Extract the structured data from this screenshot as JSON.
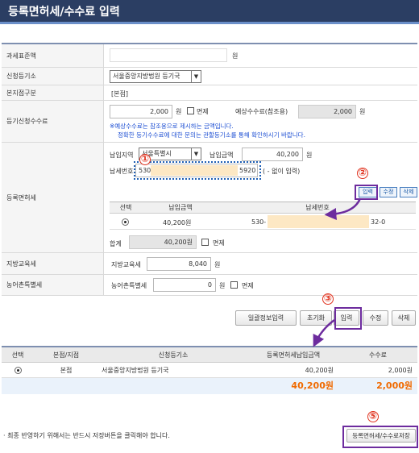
{
  "title": "등록면허세/수수료 입력",
  "fields": {
    "tax_base": {
      "label": "과세표준액",
      "value": "",
      "unit": "원"
    },
    "registry": {
      "label": "신청등기소",
      "selected": "서울중앙지방법원 등기국"
    },
    "branch": {
      "label": "본지점구분",
      "value": "[본점]"
    },
    "fee": {
      "label": "등기신청수수료",
      "value": "2,000",
      "unit": "원",
      "exempt_label": "면제",
      "expected_label": "예상수수료(참조용)",
      "expected_value": "2,000",
      "expected_unit": "원",
      "note1": "※예상수수료는 참조용으로 제시하는 금액입니다.",
      "note2": "정확한 등기수수료에 대한 문의는 관할등기소를 통해 확인하시기 바랍니다."
    },
    "license_tax": {
      "label": "등록면허세",
      "region_label": "납입지역",
      "region_value": "서울특별시",
      "amount_label": "납입금액",
      "amount_value": "40,200",
      "amount_unit": "원",
      "payno_label": "납세번호",
      "payno_prefix": "530",
      "payno_suffix": "5920",
      "payno_hint": "( - 없이 입력)",
      "btn_input": "입력",
      "btn_edit": "수정",
      "btn_delete": "삭제",
      "table_headers": [
        "선택",
        "납입금액",
        "납세번호"
      ],
      "table_row": {
        "amount": "40,200원",
        "payno_prefix": "530-",
        "payno_suffix": "32-0"
      },
      "total_label": "합계",
      "total_value": "40,200원",
      "total_exempt_label": "면제"
    },
    "local_edu_tax": {
      "label": "지방교육세",
      "inner_label": "지방교육세",
      "value": "8,040",
      "unit": "원"
    },
    "rural_tax": {
      "label": "농어촌특별세",
      "inner_label": "농어촌특별세",
      "value": "0",
      "unit": "원",
      "exempt_label": "면제"
    }
  },
  "actions": {
    "bulk_input": "일괄정보입력",
    "reset": "초기화",
    "input": "입력",
    "edit": "수정",
    "delete": "삭제"
  },
  "summary_table": {
    "headers": [
      "선택",
      "본점/지점",
      "신청등기소",
      "등록면허세납입금액",
      "수수료"
    ],
    "rows": [
      {
        "branch": "본점",
        "registry": "서울중앙지방법원 등기국",
        "tax": "40,200원",
        "fee": "2,000원"
      }
    ],
    "total_tax": "40,200원",
    "total_fee": "2,000원"
  },
  "footer": {
    "note": "· 최종 반영하기 위해서는 반드시 저장버튼을 클릭해야 합니다.",
    "save_button": "등록면허세/수수료저장"
  },
  "markers": [
    "①",
    "②",
    "③",
    "⑤"
  ],
  "colors": {
    "header_bg": "#2b3e63",
    "highlight_border": "#6d2c9e",
    "marker": "#e0321e",
    "total": "#f06a00"
  }
}
